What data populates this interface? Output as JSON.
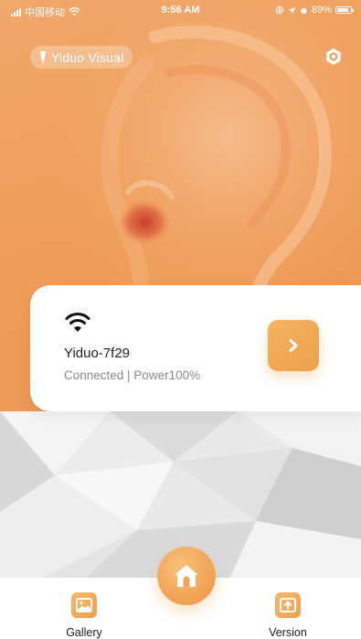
{
  "status_bar": {
    "carrier": "中国移动",
    "time": "9:56 AM",
    "battery_text": "89%",
    "battery_level": 0.89,
    "icons": [
      "signal-icon",
      "wifi-icon",
      "location-icon",
      "lock-rotation-icon",
      "battery-icon"
    ]
  },
  "header": {
    "brand_label": "Yiduo Visual",
    "brand_icon": "otoscope-icon",
    "settings_icon": "settings-icon"
  },
  "device_card": {
    "connection_icon": "wifi-icon",
    "device_name": "Yiduo-7f29",
    "status": "Connected | Power100%",
    "action_icon": "chevron-right-icon"
  },
  "bottom_nav": {
    "items": [
      {
        "label": "Gallery",
        "icon": "gallery-icon"
      },
      {
        "label": "Version",
        "icon": "upload-icon"
      }
    ],
    "home_icon": "home-icon"
  },
  "colors": {
    "accent": "#ee9f50",
    "hero_background": "#ef9d59",
    "card_background": "#ffffff",
    "muted_text": "#8a8a8a"
  }
}
